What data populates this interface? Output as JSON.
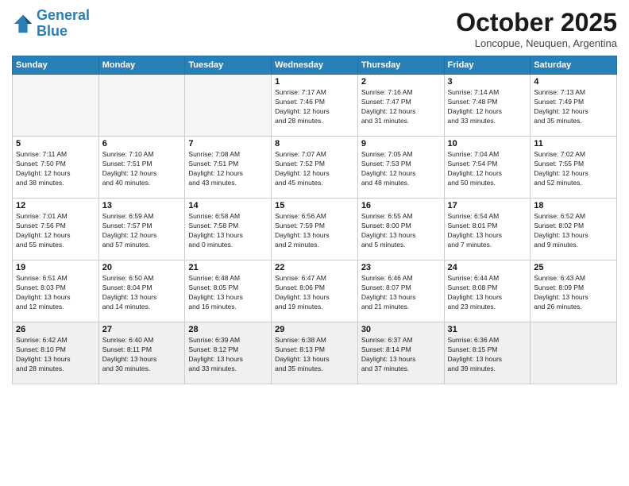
{
  "header": {
    "logo_line1": "General",
    "logo_line2": "Blue",
    "month_title": "October 2025",
    "subtitle": "Loncopue, Neuquen, Argentina"
  },
  "weekdays": [
    "Sunday",
    "Monday",
    "Tuesday",
    "Wednesday",
    "Thursday",
    "Friday",
    "Saturday"
  ],
  "weeks": [
    [
      {
        "day": "",
        "info": ""
      },
      {
        "day": "",
        "info": ""
      },
      {
        "day": "",
        "info": ""
      },
      {
        "day": "1",
        "info": "Sunrise: 7:17 AM\nSunset: 7:46 PM\nDaylight: 12 hours\nand 28 minutes."
      },
      {
        "day": "2",
        "info": "Sunrise: 7:16 AM\nSunset: 7:47 PM\nDaylight: 12 hours\nand 31 minutes."
      },
      {
        "day": "3",
        "info": "Sunrise: 7:14 AM\nSunset: 7:48 PM\nDaylight: 12 hours\nand 33 minutes."
      },
      {
        "day": "4",
        "info": "Sunrise: 7:13 AM\nSunset: 7:49 PM\nDaylight: 12 hours\nand 35 minutes."
      }
    ],
    [
      {
        "day": "5",
        "info": "Sunrise: 7:11 AM\nSunset: 7:50 PM\nDaylight: 12 hours\nand 38 minutes."
      },
      {
        "day": "6",
        "info": "Sunrise: 7:10 AM\nSunset: 7:51 PM\nDaylight: 12 hours\nand 40 minutes."
      },
      {
        "day": "7",
        "info": "Sunrise: 7:08 AM\nSunset: 7:51 PM\nDaylight: 12 hours\nand 43 minutes."
      },
      {
        "day": "8",
        "info": "Sunrise: 7:07 AM\nSunset: 7:52 PM\nDaylight: 12 hours\nand 45 minutes."
      },
      {
        "day": "9",
        "info": "Sunrise: 7:05 AM\nSunset: 7:53 PM\nDaylight: 12 hours\nand 48 minutes."
      },
      {
        "day": "10",
        "info": "Sunrise: 7:04 AM\nSunset: 7:54 PM\nDaylight: 12 hours\nand 50 minutes."
      },
      {
        "day": "11",
        "info": "Sunrise: 7:02 AM\nSunset: 7:55 PM\nDaylight: 12 hours\nand 52 minutes."
      }
    ],
    [
      {
        "day": "12",
        "info": "Sunrise: 7:01 AM\nSunset: 7:56 PM\nDaylight: 12 hours\nand 55 minutes."
      },
      {
        "day": "13",
        "info": "Sunrise: 6:59 AM\nSunset: 7:57 PM\nDaylight: 12 hours\nand 57 minutes."
      },
      {
        "day": "14",
        "info": "Sunrise: 6:58 AM\nSunset: 7:58 PM\nDaylight: 13 hours\nand 0 minutes."
      },
      {
        "day": "15",
        "info": "Sunrise: 6:56 AM\nSunset: 7:59 PM\nDaylight: 13 hours\nand 2 minutes."
      },
      {
        "day": "16",
        "info": "Sunrise: 6:55 AM\nSunset: 8:00 PM\nDaylight: 13 hours\nand 5 minutes."
      },
      {
        "day": "17",
        "info": "Sunrise: 6:54 AM\nSunset: 8:01 PM\nDaylight: 13 hours\nand 7 minutes."
      },
      {
        "day": "18",
        "info": "Sunrise: 6:52 AM\nSunset: 8:02 PM\nDaylight: 13 hours\nand 9 minutes."
      }
    ],
    [
      {
        "day": "19",
        "info": "Sunrise: 6:51 AM\nSunset: 8:03 PM\nDaylight: 13 hours\nand 12 minutes."
      },
      {
        "day": "20",
        "info": "Sunrise: 6:50 AM\nSunset: 8:04 PM\nDaylight: 13 hours\nand 14 minutes."
      },
      {
        "day": "21",
        "info": "Sunrise: 6:48 AM\nSunset: 8:05 PM\nDaylight: 13 hours\nand 16 minutes."
      },
      {
        "day": "22",
        "info": "Sunrise: 6:47 AM\nSunset: 8:06 PM\nDaylight: 13 hours\nand 19 minutes."
      },
      {
        "day": "23",
        "info": "Sunrise: 6:46 AM\nSunset: 8:07 PM\nDaylight: 13 hours\nand 21 minutes."
      },
      {
        "day": "24",
        "info": "Sunrise: 6:44 AM\nSunset: 8:08 PM\nDaylight: 13 hours\nand 23 minutes."
      },
      {
        "day": "25",
        "info": "Sunrise: 6:43 AM\nSunset: 8:09 PM\nDaylight: 13 hours\nand 26 minutes."
      }
    ],
    [
      {
        "day": "26",
        "info": "Sunrise: 6:42 AM\nSunset: 8:10 PM\nDaylight: 13 hours\nand 28 minutes."
      },
      {
        "day": "27",
        "info": "Sunrise: 6:40 AM\nSunset: 8:11 PM\nDaylight: 13 hours\nand 30 minutes."
      },
      {
        "day": "28",
        "info": "Sunrise: 6:39 AM\nSunset: 8:12 PM\nDaylight: 13 hours\nand 33 minutes."
      },
      {
        "day": "29",
        "info": "Sunrise: 6:38 AM\nSunset: 8:13 PM\nDaylight: 13 hours\nand 35 minutes."
      },
      {
        "day": "30",
        "info": "Sunrise: 6:37 AM\nSunset: 8:14 PM\nDaylight: 13 hours\nand 37 minutes."
      },
      {
        "day": "31",
        "info": "Sunrise: 6:36 AM\nSunset: 8:15 PM\nDaylight: 13 hours\nand 39 minutes."
      },
      {
        "day": "",
        "info": ""
      }
    ]
  ]
}
